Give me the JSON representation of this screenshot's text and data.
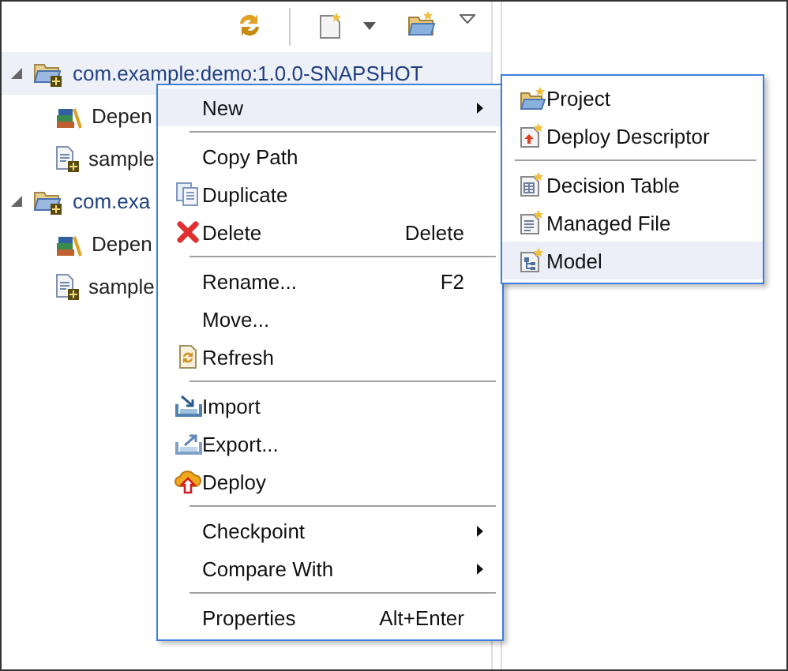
{
  "tree": [
    {
      "label": "com.example:demo:1.0.0-SNAPSHOT",
      "expanded": true,
      "selected": true,
      "children": [
        {
          "label": "Depen"
        },
        {
          "label": "sample"
        }
      ]
    },
    {
      "label": "com.exa",
      "expanded": true,
      "selected": false,
      "children": [
        {
          "label": "Depen"
        },
        {
          "label": "sample"
        }
      ]
    }
  ],
  "context_menu": [
    {
      "kind": "submenu",
      "label": "New",
      "selected": true
    },
    {
      "kind": "separator"
    },
    {
      "kind": "item",
      "label": "Copy Path",
      "selected": false
    },
    {
      "kind": "item",
      "label": "Duplicate",
      "selected": false
    },
    {
      "kind": "item",
      "label": "Delete",
      "shortcut": "Delete",
      "selected": false
    },
    {
      "kind": "separator"
    },
    {
      "kind": "item",
      "label": "Rename...",
      "shortcut": "F2",
      "selected": false
    },
    {
      "kind": "item",
      "label": "Move...",
      "selected": false
    },
    {
      "kind": "item",
      "label": "Refresh",
      "selected": false
    },
    {
      "kind": "separator"
    },
    {
      "kind": "item",
      "label": "Import",
      "selected": false
    },
    {
      "kind": "item",
      "label": "Export...",
      "selected": false
    },
    {
      "kind": "item",
      "label": "Deploy",
      "selected": false
    },
    {
      "kind": "separator"
    },
    {
      "kind": "submenu",
      "label": "Checkpoint",
      "selected": false
    },
    {
      "kind": "submenu",
      "label": "Compare With",
      "selected": false
    },
    {
      "kind": "separator"
    },
    {
      "kind": "item",
      "label": "Properties",
      "shortcut": "Alt+Enter",
      "selected": false
    }
  ],
  "submenu": [
    {
      "kind": "item",
      "label": "Project",
      "selected": false
    },
    {
      "kind": "item",
      "label": "Deploy Descriptor",
      "selected": false
    },
    {
      "kind": "separator"
    },
    {
      "kind": "item",
      "label": "Decision Table",
      "selected": false
    },
    {
      "kind": "item",
      "label": "Managed File",
      "selected": false
    },
    {
      "kind": "item",
      "label": "Model",
      "selected": true
    }
  ]
}
